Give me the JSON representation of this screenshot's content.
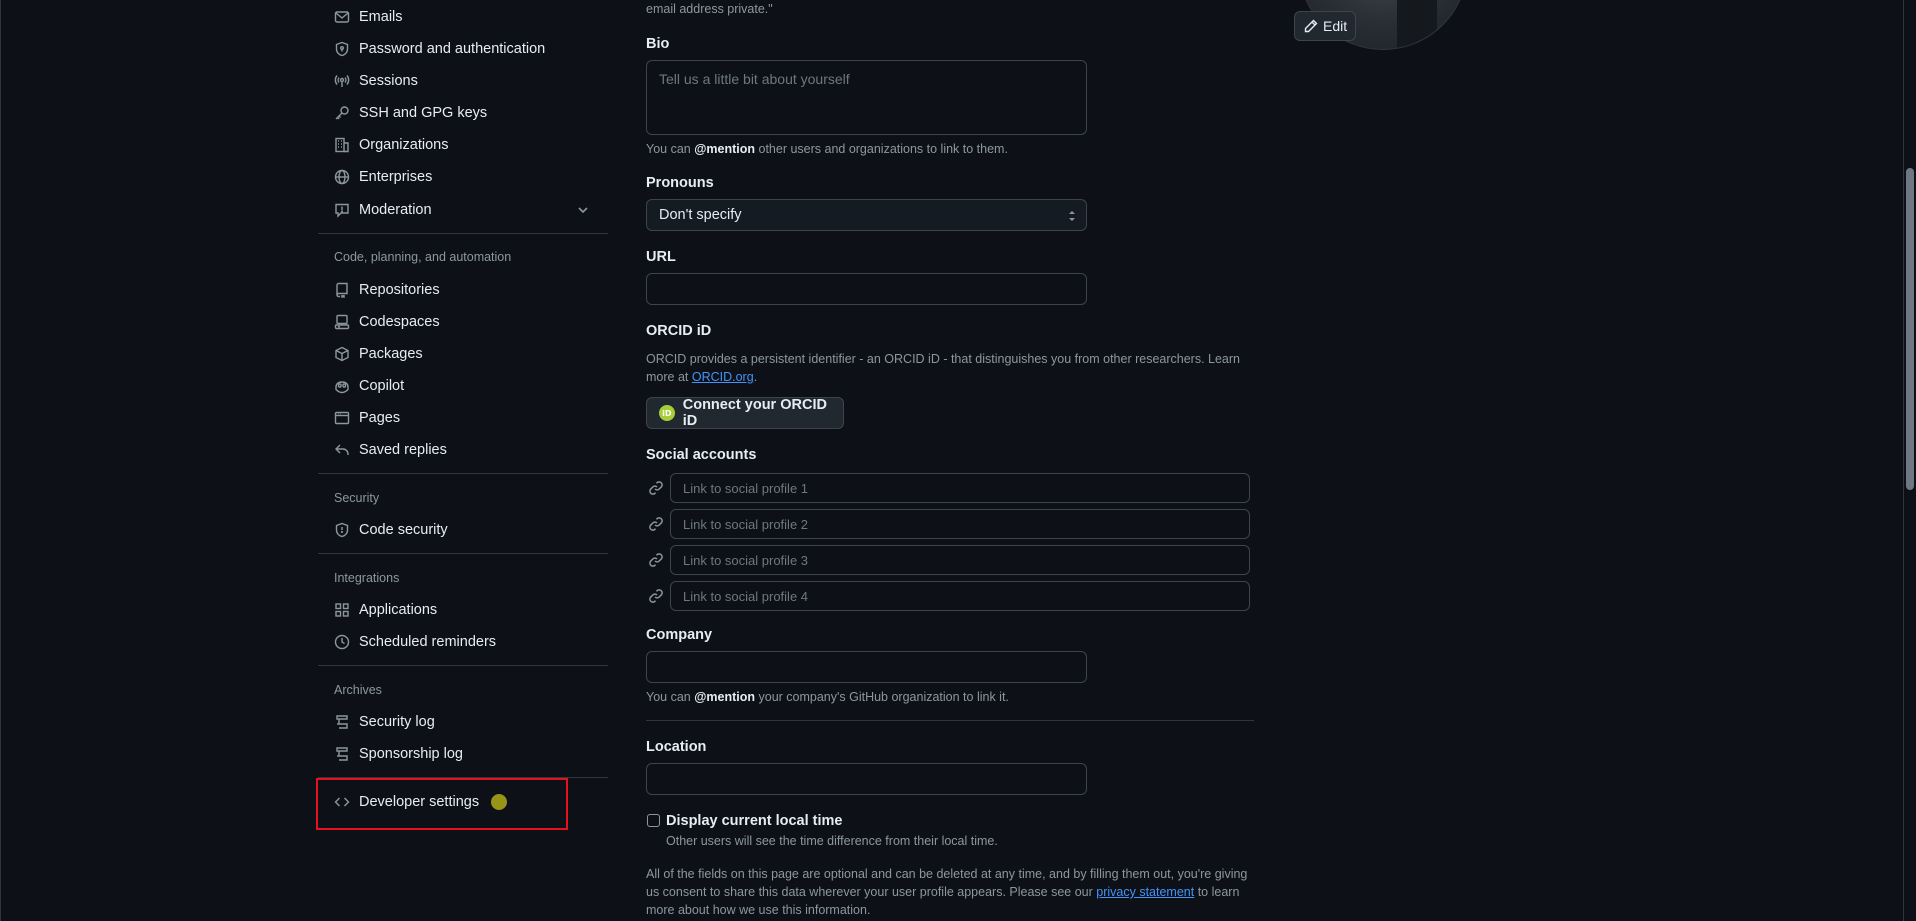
{
  "sidebar": {
    "items_top": [
      {
        "label": "Emails",
        "icon": "mail-icon"
      },
      {
        "label": "Password and authentication",
        "icon": "shield-lock-icon"
      },
      {
        "label": "Sessions",
        "icon": "broadcast-icon"
      },
      {
        "label": "SSH and GPG keys",
        "icon": "key-icon"
      },
      {
        "label": "Organizations",
        "icon": "organization-icon"
      },
      {
        "label": "Enterprises",
        "icon": "globe-icon"
      },
      {
        "label": "Moderation",
        "icon": "report-icon"
      }
    ],
    "section_code": "Code, planning, and automation",
    "items_code": [
      {
        "label": "Repositories",
        "icon": "repo-icon"
      },
      {
        "label": "Codespaces",
        "icon": "codespaces-icon"
      },
      {
        "label": "Packages",
        "icon": "package-icon"
      },
      {
        "label": "Copilot",
        "icon": "copilot-icon"
      },
      {
        "label": "Pages",
        "icon": "browser-icon"
      },
      {
        "label": "Saved replies",
        "icon": "reply-icon"
      }
    ],
    "section_security": "Security",
    "items_security": [
      {
        "label": "Code security",
        "icon": "shield-icon"
      }
    ],
    "section_integrations": "Integrations",
    "items_integrations": [
      {
        "label": "Applications",
        "icon": "apps-icon"
      },
      {
        "label": "Scheduled reminders",
        "icon": "clock-icon"
      }
    ],
    "section_archives": "Archives",
    "items_archives": [
      {
        "label": "Security log",
        "icon": "log-icon"
      },
      {
        "label": "Sponsorship log",
        "icon": "log-icon"
      }
    ],
    "developer_settings": {
      "label": "Developer settings",
      "icon": "code-icon"
    }
  },
  "form": {
    "email_private_tail": "email address private.\"",
    "bio": {
      "label": "Bio",
      "placeholder": "Tell us a little bit about yourself",
      "note_prefix": "You can ",
      "note_mention": "@mention",
      "note_suffix": " other users and organizations to link to them."
    },
    "pronouns": {
      "label": "Pronouns",
      "value": "Don't specify"
    },
    "url": {
      "label": "URL",
      "value": ""
    },
    "orcid": {
      "label": "ORCID iD",
      "note": "ORCID provides a persistent identifier - an ORCID iD - that distinguishes you from other researchers. Learn more at ",
      "link": "ORCID.org",
      "note_end": ".",
      "button": "Connect your ORCID iD",
      "logo_text": "iD"
    },
    "social": {
      "label": "Social accounts",
      "placeholders": [
        "Link to social profile 1",
        "Link to social profile 2",
        "Link to social profile 3",
        "Link to social profile 4"
      ]
    },
    "company": {
      "label": "Company",
      "value": "",
      "note_prefix": "You can ",
      "note_mention": "@mention",
      "note_suffix": " your company's GitHub organization to link it."
    },
    "location": {
      "label": "Location",
      "value": ""
    },
    "local_time": {
      "label": "Display current local time",
      "note": "Other users will see the time difference from their local time.",
      "checked": false
    },
    "footer": {
      "text_1": "All of the fields on this page are optional and can be deleted at any time, and by filling them out, you're giving us consent to share this data wherever your user profile appears. Please see our ",
      "link": "privacy statement",
      "text_2": " to learn more about how we use this information."
    }
  },
  "avatar": {
    "edit_label": "Edit"
  },
  "colors": {
    "background": "#0d1117",
    "highlight": "#e5121b",
    "link": "#4493f8",
    "orcid": "#a6ce39"
  }
}
